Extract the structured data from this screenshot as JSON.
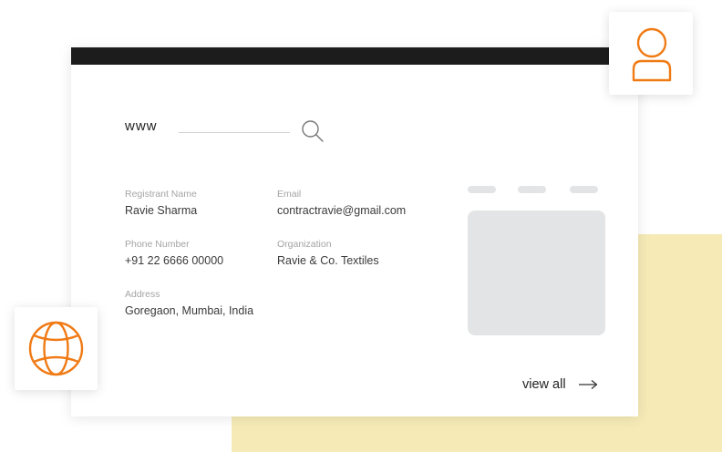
{
  "search": {
    "prefix": "www",
    "icon": "search-icon"
  },
  "fields": {
    "registrant": {
      "label": "Registrant Name",
      "value": "Ravie Sharma"
    },
    "email": {
      "label": "Email",
      "value": "contractravie@gmail.com"
    },
    "phone": {
      "label": "Phone Number",
      "value": "+91 22 6666 00000"
    },
    "organization": {
      "label": "Organization",
      "value": "Ravie & Co. Textiles"
    },
    "address": {
      "label": "Address",
      "value": "Goregaon, Mumbai, India"
    }
  },
  "footer": {
    "view_all_label": "view all",
    "arrow_icon": "arrow-right-icon"
  },
  "tiles": {
    "user_icon": "user-icon",
    "globe_icon": "globe-icon"
  },
  "colors": {
    "accent": "#f07a14",
    "top_bar": "#1c1c1c",
    "background_block": "#f6ebb7",
    "placeholder": "#e3e4e5"
  }
}
